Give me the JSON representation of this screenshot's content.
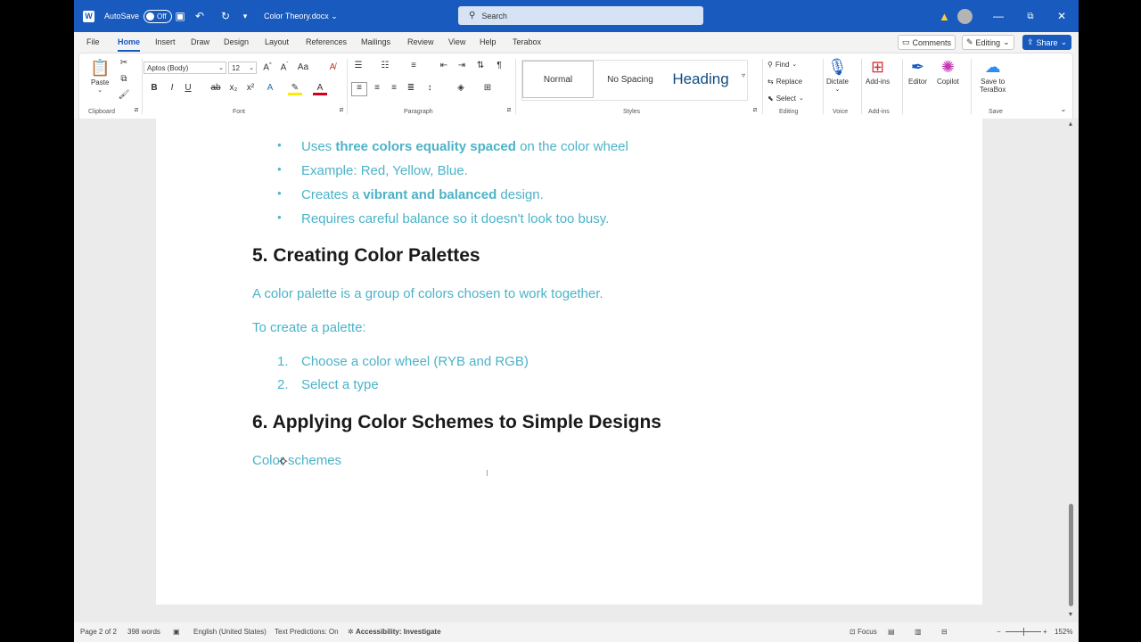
{
  "titlebar": {
    "autosave_label": "AutoSave",
    "autosave_state": "Off",
    "doc_name": "Color Theory.docx",
    "search_placeholder": "Search",
    "minimize": "—",
    "restore": "⧉",
    "close": "✕"
  },
  "tabs": [
    "File",
    "Home",
    "Insert",
    "Draw",
    "Design",
    "Layout",
    "References",
    "Mailings",
    "Review",
    "View",
    "Help",
    "Terabox"
  ],
  "active_tab": "Home",
  "top_buttons": {
    "comments": "Comments",
    "editing": "Editing",
    "share": "Share"
  },
  "ribbon": {
    "clipboard": {
      "paste": "Paste",
      "label": "Clipboard"
    },
    "font": {
      "family": "Aptos (Body)",
      "size": "12",
      "label": "Font"
    },
    "paragraph": {
      "label": "Paragraph"
    },
    "styles": {
      "items": [
        "Normal",
        "No Spacing",
        "Heading"
      ],
      "label": "Styles"
    },
    "editing": {
      "find": "Find",
      "replace": "Replace",
      "select": "Select",
      "label": "Editing"
    },
    "voice": {
      "dictate": "Dictate",
      "label": "Voice"
    },
    "addins": {
      "addins": "Add-ins",
      "label": "Add-ins"
    },
    "editor": "Editor",
    "copilot": "Copilot",
    "save": {
      "terabox_line1": "Save to",
      "terabox_line2": "TeraBox",
      "label": "Save"
    }
  },
  "document": {
    "bullets": [
      {
        "pre": "Uses ",
        "bold": "three colors equality spaced",
        "post": " on the color wheel"
      },
      {
        "pre": "Example: Red, Yellow, Blue.",
        "bold": "",
        "post": ""
      },
      {
        "pre": "Creates a ",
        "bold": "vibrant and balanced",
        "post": " design."
      },
      {
        "pre": "Requires careful balance so it doesn't look too busy.",
        "bold": "",
        "post": ""
      }
    ],
    "heading5": "5. Creating Color Palettes",
    "para1": "A color palette is a group of colors chosen to work together.",
    "para2": "To create a palette:",
    "steps": [
      {
        "n": "1.",
        "text": "Choose a color wheel (RYB and RGB)"
      },
      {
        "n": "2.",
        "text": "Select a type"
      }
    ],
    "heading6": "6. Applying Color Schemes to Simple Designs",
    "para3": "Color schemes"
  },
  "status": {
    "page": "Page 2 of 2",
    "words": "398 words",
    "language": "English (United States)",
    "predictions": "Text Predictions: On",
    "accessibility": "Accessibility: Investigate",
    "focus": "Focus",
    "zoom": "152%"
  },
  "colors": {
    "accent": "#185abd",
    "body_text": "#4bb3c8"
  }
}
